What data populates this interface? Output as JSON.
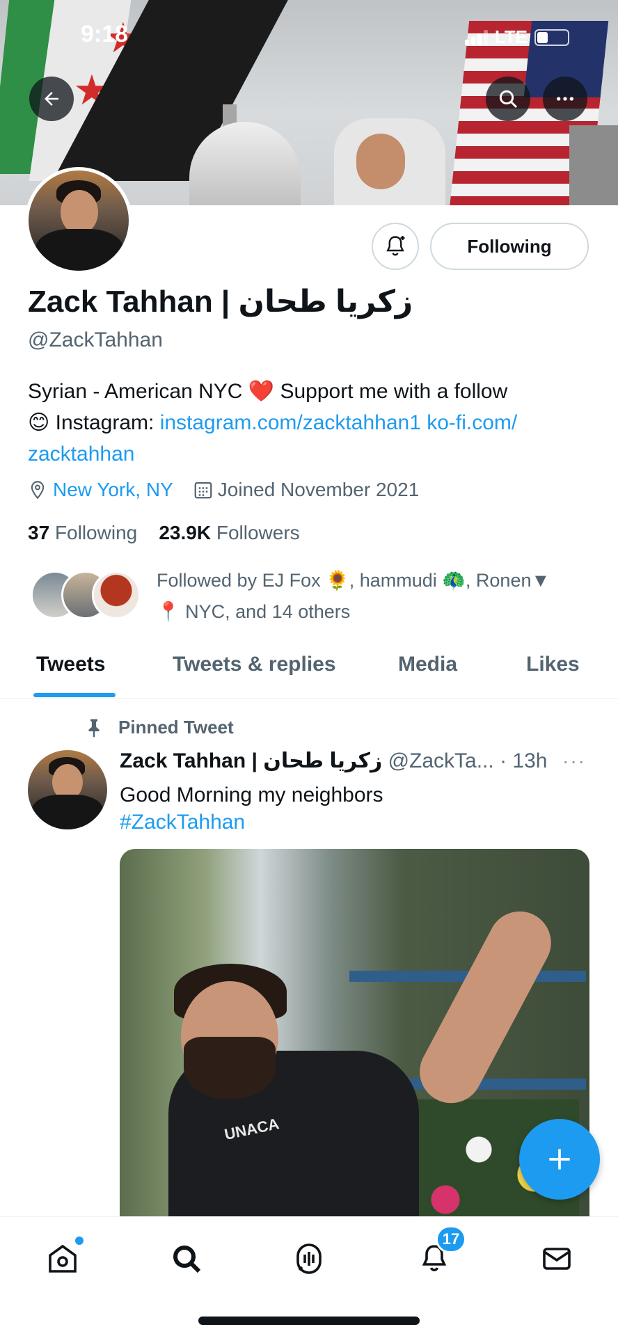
{
  "status_bar": {
    "time": "9:18",
    "network": "LTE",
    "battery_level": 0.35
  },
  "profile": {
    "display_name": "Zack Tahhan | زكريا طحان",
    "handle": "@ZackTahhan",
    "following_button_label": "Following",
    "bio": {
      "text_1": "Syrian - American NYC ",
      "heart_emoji": "❤️",
      "text_2": " Support me with a follow ",
      "smile_emoji": "😊",
      "text_3": " Instagram: ",
      "link_1": "instagram.com/zacktahhan1",
      "link_2": "ko-fi.com/ zacktahhan"
    },
    "location": "New York, NY",
    "joined": "Joined November 2021",
    "following_count": "37",
    "following_label": "Following",
    "followers_count": "23.9K",
    "followers_label": "Followers",
    "followed_by": {
      "prefix": "Followed by EJ Fox ",
      "emoji_1": "🌻",
      "middle": ", hammudi ",
      "emoji_2": "🦚",
      "middle_2": ", Ronen▼",
      "emoji_3": "📍",
      "suffix": " NYC, and 14 others"
    }
  },
  "tabs": [
    {
      "label": "Tweets",
      "active": true
    },
    {
      "label": "Tweets & replies",
      "active": false
    },
    {
      "label": "Media",
      "active": false
    },
    {
      "label": "Likes",
      "active": false
    }
  ],
  "tweet": {
    "pinned_label": "Pinned Tweet",
    "author_name": "Zack Tahhan | زكريا طحان",
    "author_handle_time": "@ZackTa... · 13h",
    "more": "···",
    "text": "Good Morning my neighbors",
    "hashtag": "#ZackTahhan",
    "photo_logo_text": "UNACA"
  },
  "bottom_nav": {
    "items": [
      {
        "icon": "home-icon",
        "has_dot": true
      },
      {
        "icon": "search-icon"
      },
      {
        "icon": "spaces-icon"
      },
      {
        "icon": "notifications-icon",
        "badge": "17"
      },
      {
        "icon": "messages-icon"
      }
    ]
  },
  "icons": {
    "back": "back-arrow-icon",
    "search": "search-icon",
    "more": "more-icon",
    "bell": "bell-plus-icon",
    "location": "location-pin-icon",
    "calendar": "calendar-icon",
    "pin": "pin-icon",
    "compose": "plus-icon"
  },
  "colors": {
    "accent": "#1d9bf0",
    "text": "#0f1419",
    "secondary": "#536471",
    "border": "#cfd9de"
  }
}
